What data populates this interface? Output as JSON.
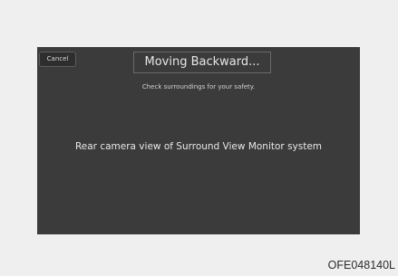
{
  "screen": {
    "cancel_label": "Cancel",
    "title": "Moving Backward...",
    "subtitle": "Check surroundings for your safety.",
    "camera_view_text": "Rear camera view of Surround View Monitor system"
  },
  "figure": {
    "code": "OFE048140L"
  },
  "colors": {
    "screen_background": "#3b3b3b",
    "page_background": "#efefef",
    "text": "#e6e6e6"
  }
}
